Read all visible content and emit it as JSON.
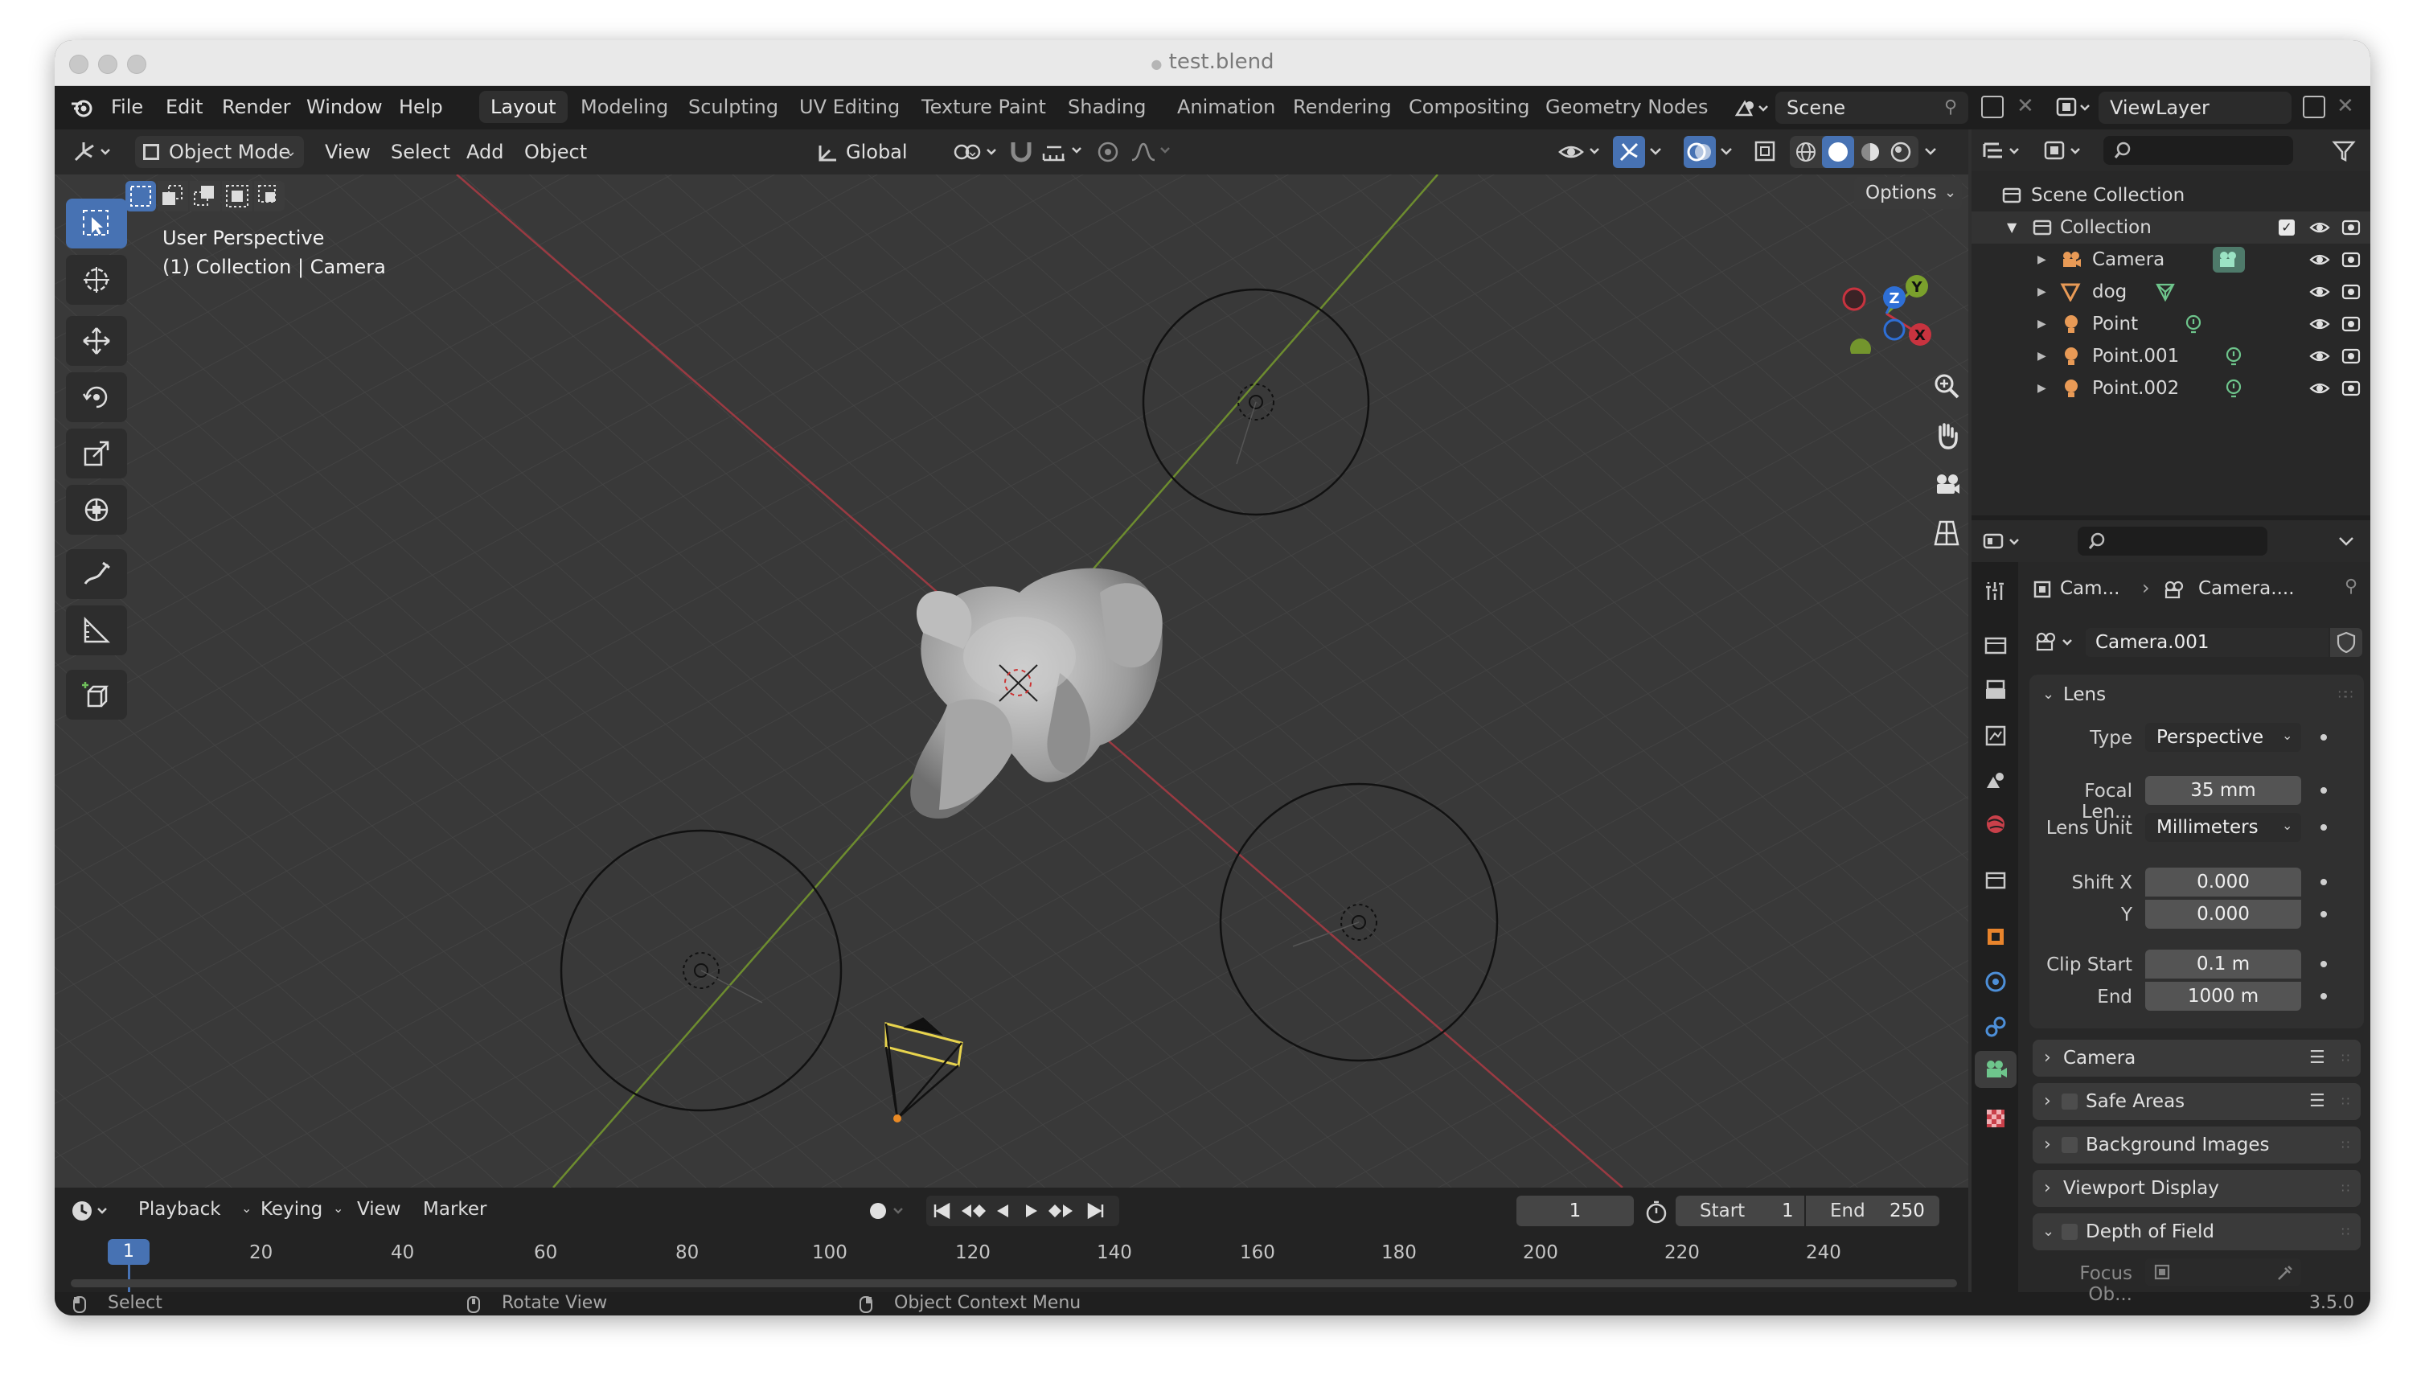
{
  "window": {
    "title": "test.blend"
  },
  "topbar": {
    "menus": [
      "File",
      "Edit",
      "Render",
      "Window",
      "Help"
    ],
    "workspaces": [
      "Layout",
      "Modeling",
      "Sculpting",
      "UV Editing",
      "Texture Paint",
      "Shading",
      "Animation",
      "Rendering",
      "Compositing",
      "Geometry Nodes"
    ],
    "active_workspace": "Layout",
    "scene": "Scene",
    "view_layer": "ViewLayer"
  },
  "viewport_header": {
    "mode": "Object Mode",
    "menus": [
      "View",
      "Select",
      "Add",
      "Object"
    ],
    "orientation": "Global",
    "options": "Options"
  },
  "viewport": {
    "overlay_title": "User Perspective",
    "overlay_sub": "(1) Collection | Camera",
    "gizmo": {
      "x": "X",
      "y": "Y",
      "z": "Z"
    }
  },
  "outliner": {
    "root": "Scene Collection",
    "collection": "Collection",
    "items": [
      "Camera",
      "dog",
      "Point",
      "Point.001",
      "Point.002"
    ]
  },
  "properties": {
    "breadcrumb_object": "Cam...",
    "breadcrumb_data": "Camera....",
    "datablock": "Camera.001",
    "lens": {
      "section": "Lens",
      "type_label": "Type",
      "type_value": "Perspective",
      "focal_label": "Focal Len...",
      "focal_value": "35 mm",
      "unit_label": "Lens Unit",
      "unit_value": "Millimeters",
      "shiftx_label": "Shift X",
      "shiftx_value": "0.000",
      "shifty_label": "Y",
      "shifty_value": "0.000",
      "clipstart_label": "Clip Start",
      "clipstart_value": "0.1 m",
      "clipend_label": "End",
      "clipend_value": "1000 m"
    },
    "sections": [
      "Camera",
      "Safe Areas",
      "Background Images",
      "Viewport Display",
      "Depth of Field"
    ],
    "focus_label": "Focus Ob..."
  },
  "timeline": {
    "menus": [
      "Playback",
      "Keying",
      "View",
      "Marker"
    ],
    "current_frame": "1",
    "start_label": "Start",
    "start_value": "1",
    "end_label": "End",
    "end_value": "250",
    "ticks": [
      "1",
      "20",
      "40",
      "60",
      "80",
      "100",
      "120",
      "140",
      "160",
      "180",
      "200",
      "220",
      "240"
    ]
  },
  "statusbar": {
    "select": "Select",
    "rotate": "Rotate View",
    "context": "Object Context Menu",
    "version": "3.5.0"
  },
  "colors": {
    "accent": "#4772b3",
    "x_axis": "#c8333f",
    "y_axis": "#7aa02c",
    "z_axis": "#2e6fd6",
    "selected": "#e8d44d"
  }
}
